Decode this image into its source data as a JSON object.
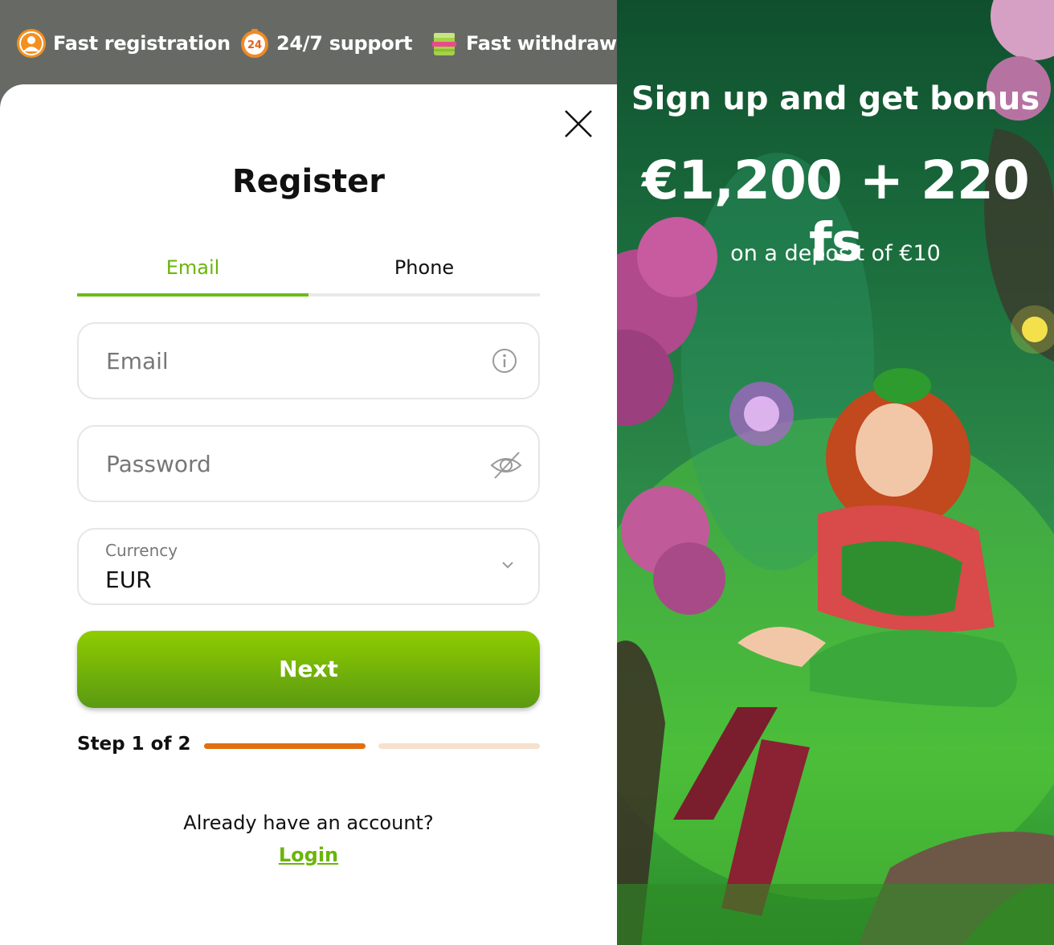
{
  "features": [
    {
      "label": "Fast registration",
      "icon": "user-icon"
    },
    {
      "label": "24/7 support",
      "icon": "clock-24-icon",
      "badge": "24"
    },
    {
      "label": "Fast withdrawal",
      "icon": "money-stack-icon"
    }
  ],
  "modal": {
    "title": "Register",
    "tabs": [
      {
        "label": "Email",
        "active": true
      },
      {
        "label": "Phone",
        "active": false
      }
    ],
    "email_placeholder": "Email",
    "password_placeholder": "Password",
    "currency": {
      "label": "Currency",
      "value": "EUR"
    },
    "next_label": "Next",
    "step": {
      "label": "Step 1 of 2",
      "current": 1,
      "total": 2
    },
    "account_question": "Already have an account?",
    "login_label": "Login"
  },
  "promo": {
    "title": "Sign up and get bonus",
    "amount": "€1,200 + 220 fs",
    "subtitle": "on a deposit of €10"
  },
  "colors": {
    "accent_green": "#6ab50a",
    "button_green_top": "#8fcc00",
    "button_green_bottom": "#5a9a12",
    "step_active": "#e16f0f",
    "step_inactive": "#f6e1cd"
  }
}
